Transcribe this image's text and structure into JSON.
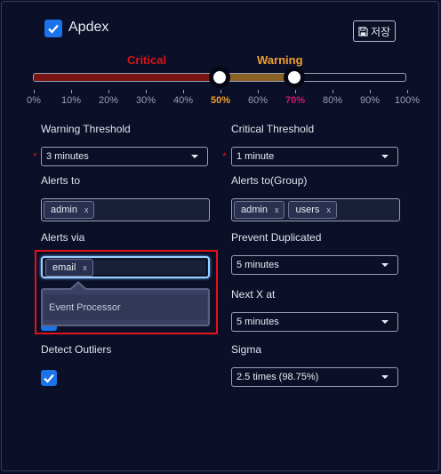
{
  "apdex": {
    "label": "Apdex",
    "checked": true
  },
  "save_button": {
    "label": "저장"
  },
  "slider": {
    "critical_label": "Critical",
    "warning_label": "Warning",
    "critical_value_pct": 50,
    "warning_value_pct": 70,
    "ticks": [
      "0%",
      "10%",
      "20%",
      "30%",
      "40%",
      "50%",
      "60%",
      "70%",
      "80%",
      "90%",
      "100%"
    ],
    "colors": {
      "critical": "#d6141a",
      "warning": "#f0a030",
      "critical_tick": "#d01a6e",
      "critical_fill": "#7a1414",
      "warning_fill": "#8a6224"
    }
  },
  "required_mark": "*",
  "warning_threshold": {
    "label": "Warning Threshold",
    "value": "3 minutes"
  },
  "critical_threshold": {
    "label": "Critical Threshold",
    "value": "1 minute"
  },
  "alerts_to": {
    "label": "Alerts to",
    "tags": [
      "admin"
    ]
  },
  "alerts_to_group": {
    "label": "Alerts to(Group)",
    "tags": [
      "admin",
      "users"
    ]
  },
  "tag_remove_glyph": "x",
  "alerts_via": {
    "label": "Alerts via",
    "tags": [
      "email"
    ],
    "dropdown_option": "Event Processor"
  },
  "prevent_duplicated": {
    "label": "Prevent Duplicated",
    "value": "5 minutes"
  },
  "next_x_at": {
    "label": "Next X at",
    "value": "5 minutes"
  },
  "detect_outliers": {
    "label": "Detect Outliers",
    "checked": true
  },
  "sigma": {
    "label": "Sigma",
    "value": "2.5 times (98.75%)"
  }
}
